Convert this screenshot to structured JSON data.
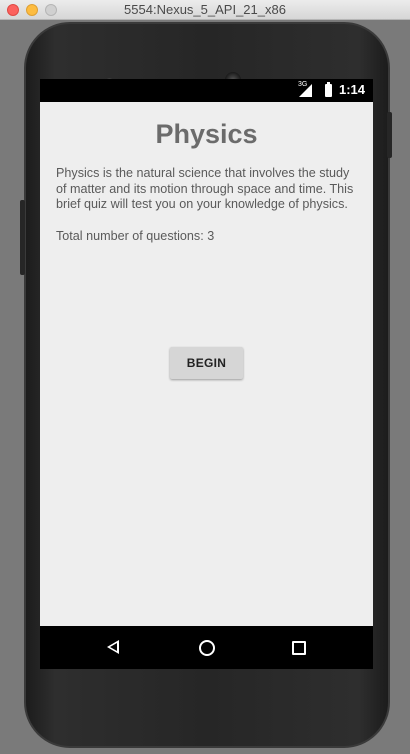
{
  "window": {
    "title": "5554:Nexus_5_API_21_x86"
  },
  "status_bar": {
    "network_label": "3G",
    "time": "1:14"
  },
  "app": {
    "title": "Physics",
    "description": "Physics is the natural science that involves the study of matter and its motion through space and time. This brief quiz will test you on your knowledge of physics.",
    "question_count_text": "Total number of questions: 3",
    "begin_label": "BEGIN"
  },
  "navigation": {
    "items": [
      "back",
      "home",
      "recent-apps"
    ]
  },
  "colors": {
    "app_background": "#eeeeee",
    "title_text": "#6b6b6b",
    "button_background": "#d6d6d6",
    "status_bar": "#000000"
  }
}
